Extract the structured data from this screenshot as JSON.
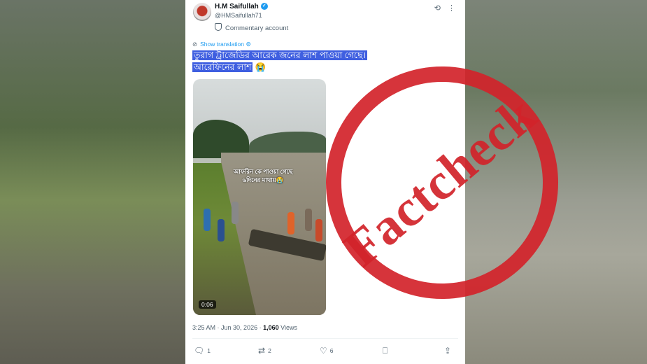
{
  "post": {
    "author_name": "H.M Saifullah",
    "handle": "@HMSaifullah71",
    "label": "Commentary account",
    "show_translation": "Show translation",
    "text_line1": "তুরাগ ট্রাজেডির আরেক জনের লাশ পাওয়া গেছে।",
    "text_line2": "আরেফিনের লাশ",
    "text_emoji": "😭",
    "video_caption_line1": "আফরিন কে পাওয়া গেছে",
    "video_caption_line2": "৬দিনের মাথায়😭",
    "video_duration": "0:06",
    "time": "3:25 AM",
    "date": "Jun 30, 2026",
    "views_count": "1,060",
    "views_label": "Views",
    "replies": "1",
    "reposts": "2",
    "likes": "6"
  },
  "stamp": {
    "text": "Factcheck",
    "color": "#d2232a"
  },
  "icons": [
    "verified-badge-icon",
    "grok-icon",
    "more-icon",
    "globe-icon",
    "shield-icon",
    "reply-icon",
    "repost-icon",
    "like-icon",
    "bookmark-icon",
    "share-icon"
  ]
}
